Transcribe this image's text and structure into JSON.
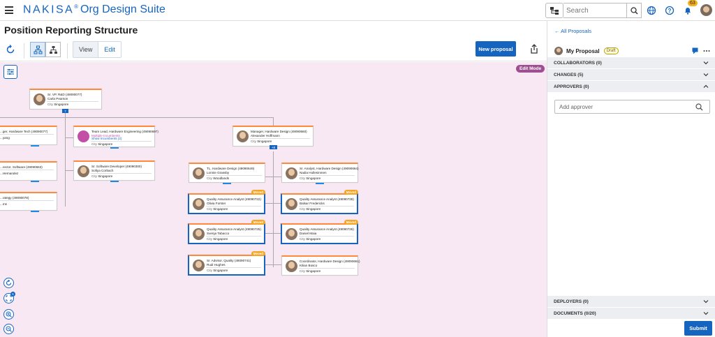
{
  "app": {
    "brand": "NAKISA",
    "registered": "®",
    "suite": "Org Design Suite"
  },
  "header": {
    "search_placeholder": "Search",
    "notification_count": "63"
  },
  "page": {
    "title": "Position Reporting Structure"
  },
  "toolbar": {
    "view_label": "View",
    "edit_label": "Edit",
    "new_proposal_label": "New proposal",
    "edit_mode_badge": "Edit Mode"
  },
  "cards": [
    {
      "title": "Sr. VP, R&D (49090077)",
      "name": "Carla Pearson",
      "city_label": "City",
      "city": "Singapore",
      "photo": "person"
    },
    {
      "title": "...ger, Hardware Tech (49090077)",
      "name": "...yang",
      "city_label": "",
      "city": "",
      "photo": "none"
    },
    {
      "title": "Team Lead, Hardware Engineering (49090697)",
      "name": "Multiple Incumbents",
      "link": "Show Incumbents (2)",
      "city_label": "City",
      "city": "Singapore",
      "photo": "vacant"
    },
    {
      "title": "Manager, Hardware Design (49090660)",
      "name": "Alexander Hoffmann",
      "city_label": "City",
      "city": "Singapore",
      "photo": "person"
    },
    {
      "title": "...rector, Software (49090663)",
      "name": "...Hernandez",
      "city_label": "",
      "city": "",
      "photo": "none"
    },
    {
      "title": "Sr. Software Developer (49090300)",
      "name": "Sofiya Corbach",
      "city_label": "City",
      "city": "Singapore",
      "photo": "person"
    },
    {
      "title": "TL, Hardware Design (49090649)",
      "name": "Lonnie Grassby",
      "city_label": "City",
      "city": "Woodlands",
      "photo": "person"
    },
    {
      "title": "Sr. Analyst, Hardware Design (49090664)",
      "name": "Nadia Hullesinmen",
      "city_label": "City",
      "city": "Singapore",
      "photo": "person"
    },
    {
      "title": "...rategy (49090078)",
      "name": "...ms",
      "city_label": "",
      "city": "",
      "photo": "none"
    },
    {
      "title": "Quality Assurance Analyst (49090722)",
      "name": "Olivia Forster",
      "city_label": "City",
      "city": "Singapore",
      "photo": "person",
      "tag": "Moved"
    },
    {
      "title": "Quality Assurance Analyst (49090728)",
      "name": "Balsar Fredericks",
      "city_label": "City",
      "city": "Singapore",
      "photo": "person",
      "tag": "Moved"
    },
    {
      "title": "Quality Assurance Analyst (49090725)",
      "name": "Svenja Tabacco",
      "city_label": "City",
      "city": "Singapore",
      "photo": "person",
      "tag": "Moved"
    },
    {
      "title": "Quality Assurance Analyst (49090726)",
      "name": "Daniel Maia",
      "city_label": "City",
      "city": "Singapore",
      "photo": "person",
      "tag": "Moved"
    },
    {
      "title": "Sr. Advisor, Quality (49090741)",
      "name": "Rudi Hughes",
      "city_label": "City",
      "city": "Singapore",
      "photo": "person",
      "tag": "Moved"
    },
    {
      "title": "Coordinator, Hardware Design (49090661)",
      "name": "Kilian Bosco",
      "city_label": "City",
      "city": "Singapore",
      "photo": "person"
    }
  ],
  "expanders": [
    "7",
    "+8"
  ],
  "zoom_controls": {
    "fit_badge": "5"
  },
  "panel": {
    "back_label": "All Proposals",
    "proposal_name": "My Proposal",
    "status": "Draft",
    "sections": {
      "collaborators": "COLLABORATORS (0)",
      "changes": "CHANGES (5)",
      "approvers": "APPROVERS (0)",
      "deployers": "DEPLOYERS (0)",
      "documents": "DOCUMENTS (0/20)"
    },
    "approver_placeholder": "Add approver",
    "submit_label": "Submit"
  },
  "colors": {
    "primary": "#1565c0",
    "card_accent": "#ff8a3d",
    "canvas_bg": "#f8e8f3",
    "edit_mode": "#9e4f92",
    "moved_tag": "#f5a623",
    "badge": "#f6b01e"
  }
}
